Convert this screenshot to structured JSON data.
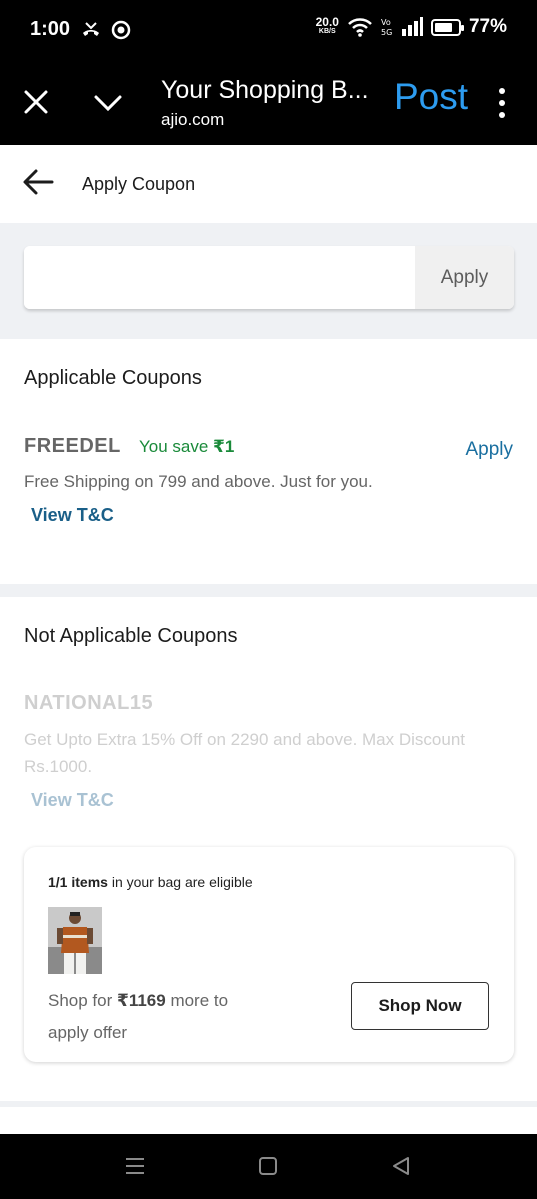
{
  "status_bar": {
    "time": "1:00",
    "speed_value": "20.0",
    "speed_unit": "KB/S",
    "battery": "77%",
    "battery_level": 0.77
  },
  "browser": {
    "title": "Your Shopping B...",
    "url": "ajio.com",
    "post_label": "Post",
    "accent_color": "#2d9cf0"
  },
  "page": {
    "title": "Apply Coupon"
  },
  "coupon_input": {
    "value": "",
    "apply_label": "Apply"
  },
  "applicable": {
    "heading": "Applicable Coupons",
    "coupons": [
      {
        "code": "FREEDEL",
        "save_prefix": "You save ",
        "save_amount": "₹1",
        "apply_label": "Apply",
        "description": "Free Shipping on 799 and above. Just for you.",
        "tnc_label": "View T&C"
      }
    ]
  },
  "not_applicable": {
    "heading": "Not Applicable Coupons",
    "coupons": [
      {
        "code": "NATIONAL15",
        "description": "Get Upto Extra 15% Off on 2290 and above. Max Discount Rs.1000.",
        "tnc_label": "View T&C",
        "eligible_count": "1/1 items",
        "eligible_suffix": " in your bag are eligible",
        "shop_prefix": "Shop for ",
        "shop_amount": "₹1169",
        "shop_suffix": " more to apply offer",
        "shop_now_label": "Shop Now"
      }
    ]
  },
  "colors": {
    "save_green": "#1a8a3a",
    "link_blue": "#1a6fa0"
  }
}
